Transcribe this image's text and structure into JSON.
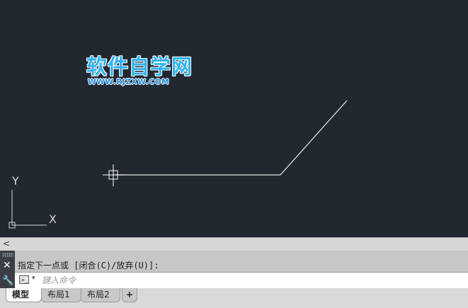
{
  "watermark": {
    "title": "软件自学网",
    "subtitle": "WWW.RJZXW.COM"
  },
  "ucs": {
    "x_label": "X",
    "y_label": "Y"
  },
  "scrollbar": {
    "left_arrow": "<"
  },
  "command_line": {
    "history": "指定下一点或 [闭合(C)/放弃(U)]:",
    "input_placeholder": "键入命令",
    "close_glyph": "✕",
    "wrench_glyph": "🔧",
    "prompt_glyph": ">_",
    "dropdown_glyph": "▾"
  },
  "layout_tabs": [
    {
      "label": "模型",
      "active": true
    },
    {
      "label": "布局1",
      "active": false
    },
    {
      "label": "布局2",
      "active": false
    },
    {
      "label": "+",
      "active": false
    }
  ],
  "colors": {
    "canvas_bg": "#212830",
    "polyline": "#e6e6e6",
    "watermark_blue": "#2fb3f0"
  }
}
